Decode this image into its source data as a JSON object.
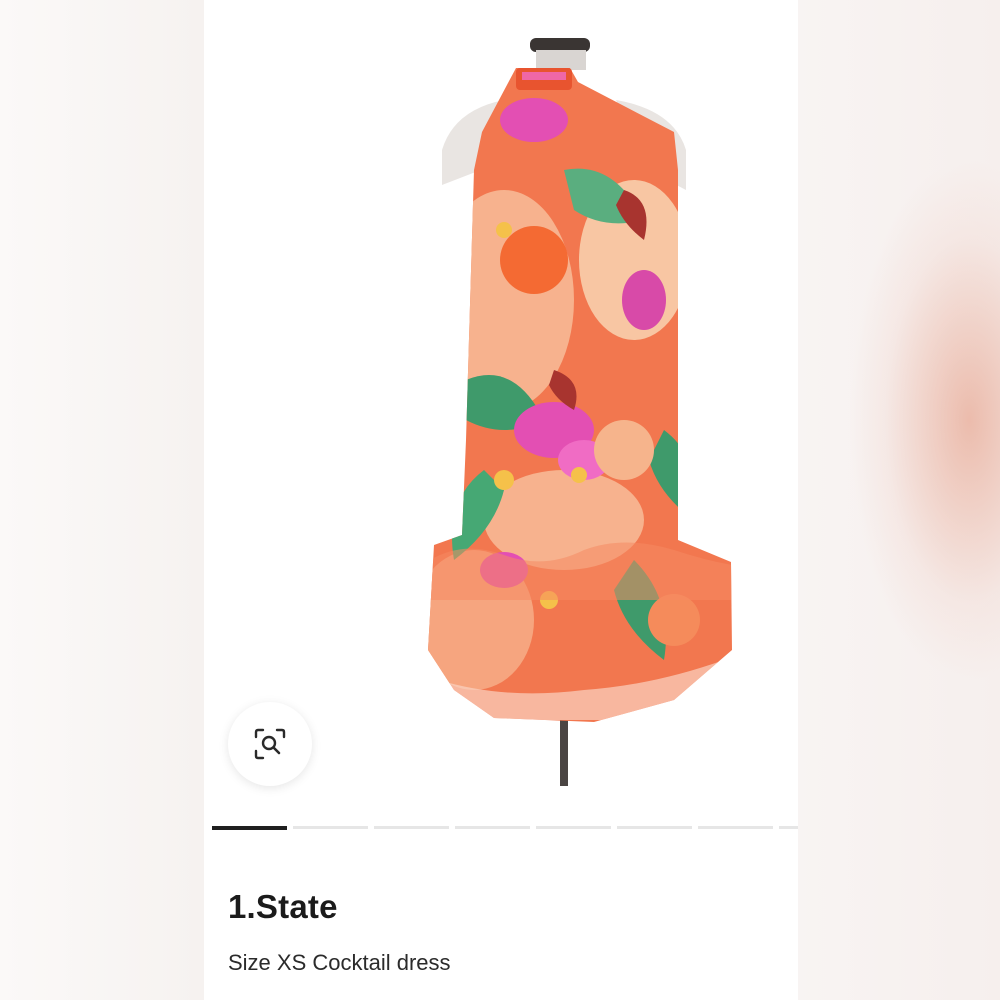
{
  "listing": {
    "brand": "1.State",
    "subtitle": "Size XS Cocktail dress"
  },
  "gallery": {
    "image_alt": "Orange tropical floral halter cocktail dress on mannequin",
    "zoom_icon": "zoom-search-icon",
    "page_count": 8,
    "active_page": 1
  },
  "colors": {
    "dress_base": "#f2774f",
    "dress_pink": "#e34fb3",
    "dress_green": "#3f9a6b",
    "dress_peach": "#f7b28e",
    "pager_active": "#1f1f1f",
    "pager_inactive": "#e6e6e6"
  }
}
